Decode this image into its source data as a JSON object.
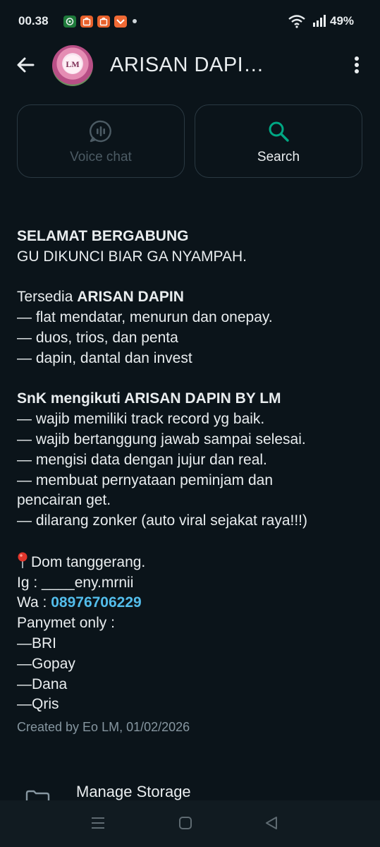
{
  "status_bar": {
    "time": "00.38",
    "battery": "49%",
    "icons": [
      "app-notification-icon",
      "shopee-icon",
      "shopee-icon",
      "game-icon",
      "more-dot-icon",
      "wifi-icon",
      "signal-icon"
    ]
  },
  "header": {
    "title": "ARISAN DAPI…",
    "avatar_text": "LM"
  },
  "actions": {
    "voice_chat_label": "Voice chat",
    "search_label": "Search"
  },
  "description": {
    "heading": "SELAMAT BERGABUNG",
    "line2": "GU DIKUNCI BIAR GA NYAMPAH.",
    "available_prefix": "Tersedia ",
    "available_bold": "ARISAN DAPIN",
    "list1": [
      "— flat mendatar, menurun dan onepay.",
      "— duos, trios, dan penta",
      "— dapin, dantal dan invest"
    ],
    "snk_heading": "SnK mengikuti ARISAN DAPIN BY LM",
    "list2": [
      "— wajib memiliki track record yg baik.",
      "— wajib bertanggung jawab sampai selesai.",
      "— mengisi data dengan jujur dan real.",
      "— membuat pernyataan peminjam dan pencairan get.",
      "— dilarang zonker (auto viral sejakat raya!!!)"
    ],
    "dom": "Dom tanggerang.",
    "ig": "Ig : ____eny.mrnii",
    "wa_prefix": "Wa : ",
    "wa_number": "08976706229",
    "payment_heading": "Panymet only :",
    "payments": [
      "—BRI",
      "—Gopay",
      "—Dana",
      "—Qris"
    ]
  },
  "created": "Created by Eo LM, 01/02/2026",
  "manage_storage": "Manage Storage",
  "colors": {
    "background": "#0b141a",
    "accent_green": "#00a884",
    "link_blue": "#53bdeb",
    "muted": "#8696a0"
  }
}
